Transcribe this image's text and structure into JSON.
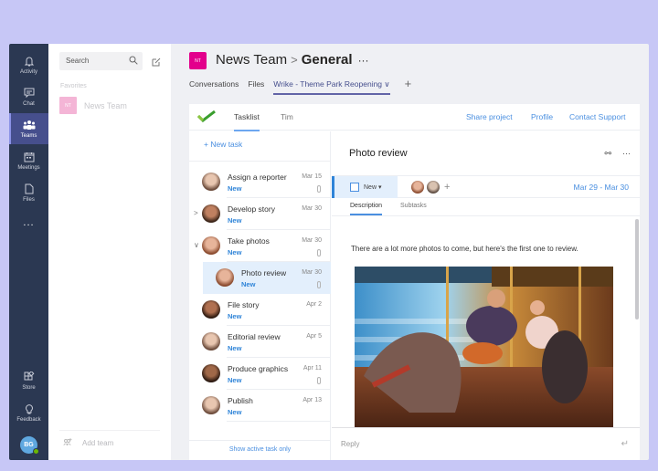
{
  "rail": {
    "items": [
      {
        "label": "Activity",
        "icon": "bell-icon"
      },
      {
        "label": "Chat",
        "icon": "chat-icon"
      },
      {
        "label": "Teams",
        "icon": "teams-icon",
        "active": true
      },
      {
        "label": "Meetings",
        "icon": "calendar-icon"
      },
      {
        "label": "Files",
        "icon": "file-icon"
      },
      {
        "label": "...",
        "icon": "more-icon"
      }
    ],
    "bottom": [
      {
        "label": "Store",
        "icon": "store-icon"
      },
      {
        "label": "Feedback",
        "icon": "lightbulb-icon"
      }
    ],
    "user_initials": "BG"
  },
  "teams_panel": {
    "search_placeholder": "Search",
    "favorites_label": "Favorites",
    "team": {
      "initials": "NT",
      "name": "News Team"
    },
    "add_team_label": "Add team"
  },
  "header": {
    "badge": "NT",
    "team": "News Team",
    "separator": ">",
    "channel": "General",
    "more": "···",
    "tabs": [
      {
        "label": "Conversations"
      },
      {
        "label": "Files"
      },
      {
        "label": "Wrike - Theme Park Reopening ∨",
        "active": true
      }
    ],
    "add_tab": "+"
  },
  "app": {
    "tabs": [
      {
        "label": "Tasklist",
        "active": true
      },
      {
        "label": "Tim"
      }
    ],
    "links": [
      "Share project",
      "Profile",
      "Contact Support"
    ],
    "new_task_label": "+  New task",
    "tasks": [
      {
        "name": "Assign a reporter",
        "status": "New",
        "date": "Mar 15",
        "attachment": true
      },
      {
        "name": "Develop story",
        "status": "New",
        "date": "Mar 30",
        "attachment": false,
        "caret": ">"
      },
      {
        "name": "Take photos",
        "status": "New",
        "date": "Mar 30",
        "attachment": true,
        "caret": "∨"
      },
      {
        "name": "Photo review",
        "status": "New",
        "date": "Mar 30",
        "attachment": true,
        "selected": true,
        "subtask": true
      },
      {
        "name": "File story",
        "status": "New",
        "date": "Apr 2",
        "attachment": false
      },
      {
        "name": "Editorial review",
        "status": "New",
        "date": "Apr 5",
        "attachment": false
      },
      {
        "name": "Produce graphics",
        "status": "New",
        "date": "Apr 11",
        "attachment": true
      },
      {
        "name": "Publish",
        "status": "New",
        "date": "Apr 13",
        "attachment": false
      }
    ],
    "show_active_label": "Show active task only",
    "detail": {
      "title": "Photo review",
      "status_label": "New ▾",
      "date_range": "Mar 29 - Mar 30",
      "tabs": [
        {
          "label": "Description",
          "active": true
        },
        {
          "label": "Subtasks"
        }
      ],
      "description": "There are a lot more photos to come, but here's the first one to review.",
      "photo_alt": "Couple riding a carousel",
      "reply_placeholder": "Reply",
      "assignee_add": "+"
    }
  },
  "colors": {
    "accent": "#6264a7",
    "link": "#4a8fe0",
    "status": "#2f84d8",
    "team_badge": "#e3008c"
  }
}
